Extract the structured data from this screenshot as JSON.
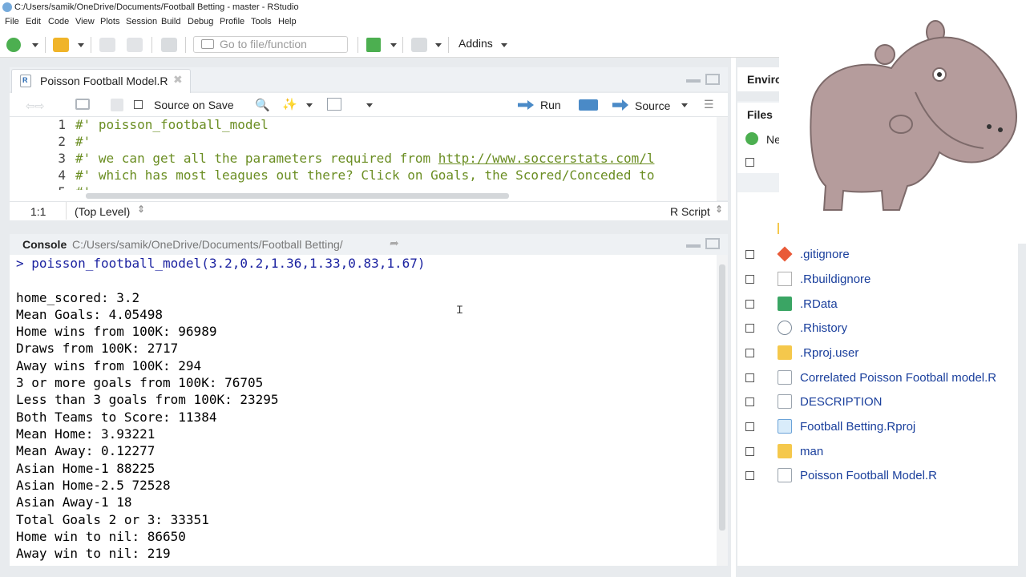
{
  "window": {
    "title": "C:/Users/samik/OneDrive/Documents/Football Betting - master - RStudio"
  },
  "menu": [
    "File",
    "Edit",
    "Code",
    "View",
    "Plots",
    "Session",
    "Build",
    "Debug",
    "Profile",
    "Tools",
    "Help"
  ],
  "toolbar": {
    "goto_placeholder": "Go to file/function",
    "addins_label": "Addins"
  },
  "editor": {
    "tab_label": "Poisson Football Model.R",
    "source_on_save_label": "Source on Save",
    "run_label": "Run",
    "source_label": "Source",
    "lines": [
      {
        "num": "1",
        "text": "#' poisson_football_model"
      },
      {
        "num": "2",
        "text": "#'"
      },
      {
        "num": "3",
        "text": "#' we can get all the parameters required from ",
        "url": "http://www.soccerstats.com/l"
      },
      {
        "num": "4",
        "text": "#' which has most leagues out there? Click on Goals, the Scored/Conceded to"
      },
      {
        "num": "5",
        "text": "#'"
      }
    ],
    "status": {
      "position": "1:1",
      "scope": "(Top Level)",
      "filetype": "R Script"
    }
  },
  "console": {
    "label": "Console",
    "path": "C:/Users/samik/OneDrive/Documents/Football Betting/",
    "prompt": "> poisson_football_model(3.2,0.2,1.36,1.33,0.83,1.67)",
    "output": [
      "home_scored: 3.2",
      "Mean Goals: 4.05498",
      "Home wins from 100K: 96989",
      "Draws from 100K: 2717",
      "Away wins from 100K: 294",
      "3 or more goals from 100K: 76705",
      "Less than 3 goals from 100K: 23295",
      "Both Teams to Score: 11384",
      "Mean Home: 3.93221",
      "Mean Away: 0.12277",
      "Asian Home-1 88225",
      "Asian Home-2.5 72528",
      "Asian Away-1 18",
      "Total Goals 2 or 3: 33351",
      "Home win to nil: 86650",
      "Away win to nil: 219"
    ]
  },
  "right": {
    "env_tab": "Enviro",
    "files_tab": "Files",
    "new_label": "Ne",
    "files": [
      {
        "name": ".gitignore",
        "icon": "git-icon"
      },
      {
        "name": ".Rbuildignore",
        "icon": "file-icon"
      },
      {
        "name": ".RData",
        "icon": "rdata-icon"
      },
      {
        "name": ".Rhistory",
        "icon": "history-icon"
      },
      {
        "name": ".Rproj.user",
        "icon": "folder-icon"
      },
      {
        "name": "Correlated Poisson Football model.R",
        "icon": "r-file-icon"
      },
      {
        "name": "DESCRIPTION",
        "icon": "r-file-icon"
      },
      {
        "name": "Football Betting.Rproj",
        "icon": "rproj-icon"
      },
      {
        "name": "man",
        "icon": "folder-icon"
      },
      {
        "name": "Poisson Football Model.R",
        "icon": "r-file-icon"
      }
    ]
  },
  "colors": {
    "accent": "#75aadb",
    "code_comment": "#6b8e23",
    "prompt": "#1c23a1",
    "link": "#1a3f9c"
  }
}
